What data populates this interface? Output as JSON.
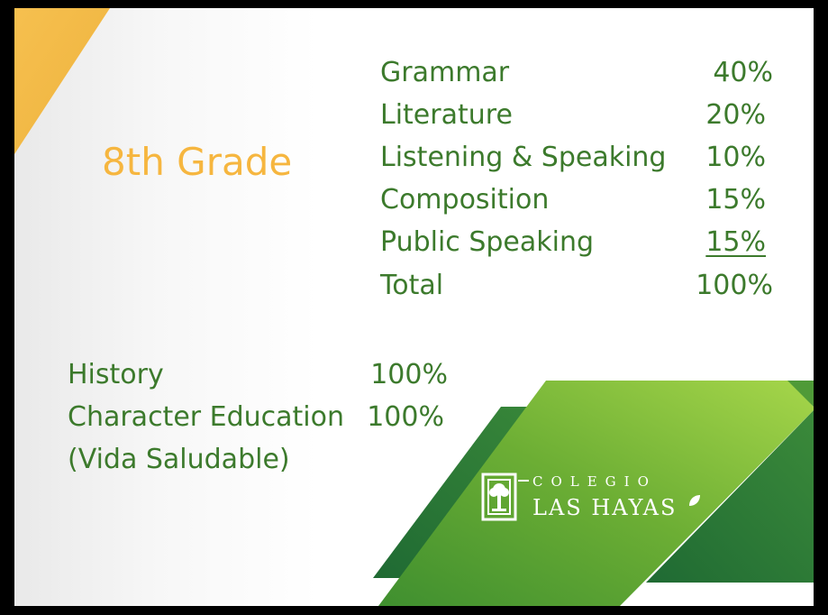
{
  "slide": {
    "title": "8th Grade",
    "weights_table": [
      {
        "label": "Grammar",
        "value": "40%"
      },
      {
        "label": "Literature",
        "value": "20%"
      },
      {
        "label": "Listening & Speaking",
        "value": "10%"
      },
      {
        "label": "Composition",
        "value": "15%"
      },
      {
        "label": "Public Speaking",
        "value": "15%"
      },
      {
        "label": "Total",
        "value": "100%"
      }
    ],
    "other_subjects": [
      {
        "label": "History",
        "value": "100%"
      },
      {
        "label": "Character Education",
        "value": "100%"
      },
      {
        "label": "(Vida Saludable)",
        "value": ""
      }
    ]
  },
  "logo": {
    "top_word": "COLEGIO",
    "main_word": "LAS HAYAS"
  },
  "colors": {
    "title": "#f6b63f",
    "text": "#3c7a2c",
    "yellow_accent": "#f4bb48",
    "green_light": "#8cc63f",
    "green_dark": "#2e7a38"
  }
}
